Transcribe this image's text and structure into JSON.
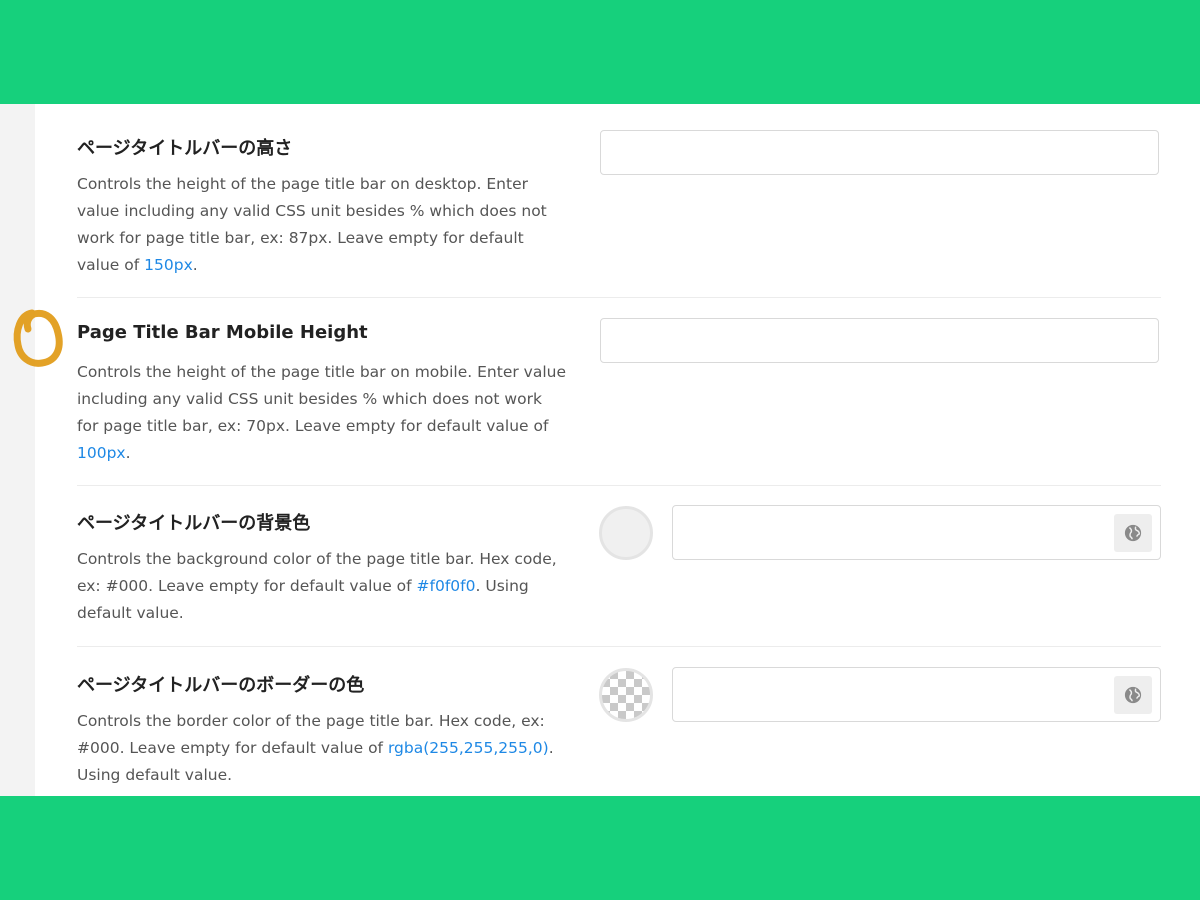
{
  "settings": [
    {
      "title": "ページタイトルバーの高さ",
      "desc_text": "Controls the height of the page title bar on desktop. Enter value including any valid CSS unit besides % which does not work for page title bar, ex: 87px. Leave empty for default value of ",
      "link": "150px",
      "desc_tail": ".",
      "input_value": ""
    },
    {
      "title": "Page Title Bar Mobile Height",
      "desc_text": "Controls the height of the page title bar on mobile. Enter value including any valid CSS unit besides % which does not work for page title bar, ex: 70px. Leave empty for default value of ",
      "link": "100px",
      "desc_tail": ".",
      "input_value": ""
    },
    {
      "title": "ページタイトルバーの背景色",
      "desc_text": "Controls the background color of the page title bar. Hex code, ex: #000. Leave empty for default value of ",
      "link": "#f0f0f0",
      "desc_tail": ". Using default value.",
      "input_value": "",
      "swatch": "solid",
      "swatch_color": "#f0f0f0",
      "button_icon": "globe-icon"
    },
    {
      "title": "ページタイトルバーのボーダーの色",
      "desc_text": "Controls the border color of the page title bar. Hex code, ex: #000. Leave empty for default value of ",
      "link": "rgba(255,255,255,0)",
      "desc_tail": ". Using default value.",
      "input_value": "",
      "swatch": "transparent",
      "button_icon": "globe-icon"
    }
  ],
  "colors": {
    "frame": "#16d07c",
    "link": "#1e88e5",
    "annotation": "#e0980f"
  }
}
